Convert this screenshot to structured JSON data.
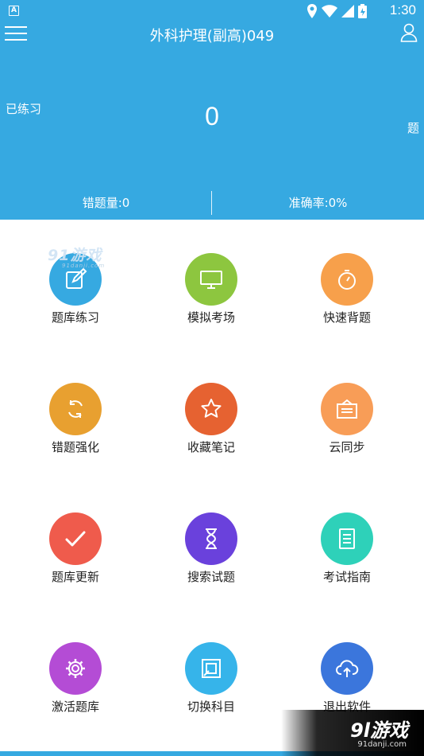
{
  "status_bar": {
    "time": "1:30"
  },
  "header": {
    "title": "外科护理(副高)049",
    "practiced_label": "已练习",
    "practiced_count": "0",
    "practiced_unit": "题",
    "wrong_count": "错题量:0",
    "accuracy": "准确率:0%"
  },
  "menu": [
    {
      "label": "题库练习",
      "color": "#36a9e1",
      "icon": "edit-icon"
    },
    {
      "label": "模拟考场",
      "color": "#8dc63f",
      "icon": "monitor-icon"
    },
    {
      "label": "快速背题",
      "color": "#f7a04b",
      "icon": "stopwatch-icon"
    },
    {
      "label": "错题强化",
      "color": "#e8a030",
      "icon": "refresh-icon"
    },
    {
      "label": "收藏笔记",
      "color": "#e66231",
      "icon": "star-icon"
    },
    {
      "label": "云同步",
      "color": "#f89d57",
      "icon": "box-icon"
    },
    {
      "label": "题库更新",
      "color": "#ef5b4c",
      "icon": "check-icon"
    },
    {
      "label": "搜索试题",
      "color": "#6a41dc",
      "icon": "hourglass-icon"
    },
    {
      "label": "考试指南",
      "color": "#2ed1b9",
      "icon": "document-icon"
    },
    {
      "label": "激活题库",
      "color": "#b44cd5",
      "icon": "gear-icon"
    },
    {
      "label": "切换科目",
      "color": "#36b4ea",
      "icon": "switch-icon"
    },
    {
      "label": "退出软件",
      "color": "#3b76dc",
      "icon": "cloud-upload-icon"
    }
  ],
  "watermark": {
    "top_brand": "91游戏",
    "top_url": "91danji.com",
    "bottom_brand": "9l游戏",
    "bottom_url": "91danji.com"
  }
}
